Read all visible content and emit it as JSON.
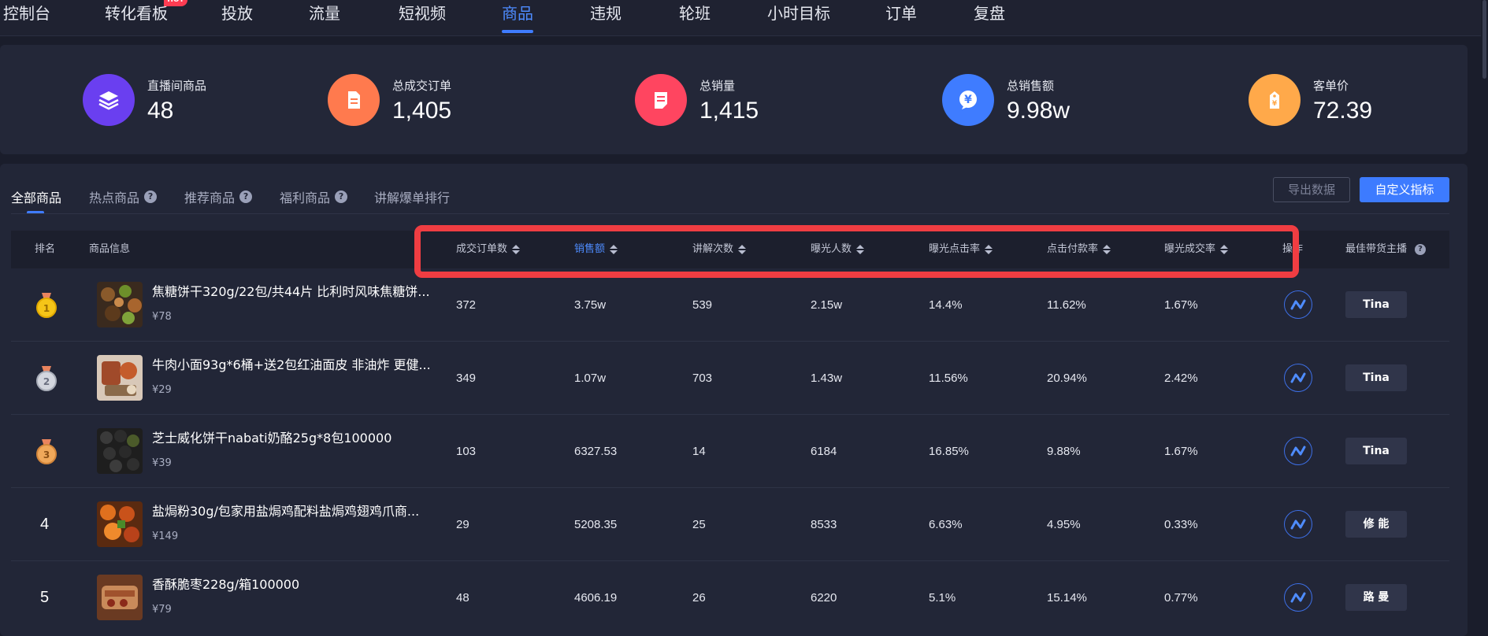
{
  "nav": {
    "items": [
      "控制台",
      "转化看板",
      "投放",
      "流量",
      "短视频",
      "商品",
      "违规",
      "轮班",
      "小时目标",
      "订单",
      "复盘"
    ],
    "hot_badge": "HOT",
    "active": "商品"
  },
  "stats": [
    {
      "label": "直播间商品",
      "value": "48",
      "icon": "layers-icon",
      "color": "#6a3ff0"
    },
    {
      "label": "总成交订单",
      "value": "1,405",
      "icon": "document-icon",
      "color": "#ff7a4e"
    },
    {
      "label": "总销量",
      "value": "1,415",
      "icon": "note-icon",
      "color": "#ff4560"
    },
    {
      "label": "总销售额",
      "value": "9.98w",
      "icon": "yuan-icon",
      "color": "#3f7cff"
    },
    {
      "label": "客单价",
      "value": "72.39",
      "icon": "price-tag-icon",
      "color": "#ffa94a"
    }
  ],
  "tabs": [
    {
      "label": "全部商品",
      "help": false,
      "active": true
    },
    {
      "label": "热点商品",
      "help": true
    },
    {
      "label": "推荐商品",
      "help": true
    },
    {
      "label": "福利商品",
      "help": true
    },
    {
      "label": "讲解爆单排行",
      "help": false
    }
  ],
  "actions": {
    "export": "导出数据",
    "custom": "自定义指标"
  },
  "table": {
    "headers": {
      "rank": "排名",
      "product": "商品信息",
      "orders": "成交订单数",
      "sales": "销售额",
      "explain": "讲解次数",
      "exposure": "曝光人数",
      "ctr": "曝光点击率",
      "pay_rate": "点击付款率",
      "conv": "曝光成交率",
      "op": "操作",
      "anchor": "最佳带货主播"
    },
    "sorted_column": "sales",
    "rows": [
      {
        "rank": "1",
        "medal": "gold",
        "name": "焦糖饼干320g/22包/共44片 比利时风味焦糖饼...",
        "price": "¥78",
        "orders": "372",
        "sales": "3.75w",
        "explain": "539",
        "exposure": "2.15w",
        "ctr": "14.4%",
        "pay_rate": "11.62%",
        "conv": "1.67%",
        "anchor": "Tina"
      },
      {
        "rank": "2",
        "medal": "silver",
        "name": "牛肉小面93g*6桶+送2包红油面皮 非油炸 更健...",
        "price": "¥29",
        "orders": "349",
        "sales": "1.07w",
        "explain": "703",
        "exposure": "1.43w",
        "ctr": "11.56%",
        "pay_rate": "20.94%",
        "conv": "2.42%",
        "anchor": "Tina"
      },
      {
        "rank": "3",
        "medal": "bronze",
        "name": "芝士威化饼干nabati奶酪25g*8包100000",
        "price": "¥39",
        "orders": "103",
        "sales": "6327.53",
        "explain": "14",
        "exposure": "6184",
        "ctr": "16.85%",
        "pay_rate": "9.88%",
        "conv": "1.67%",
        "anchor": "Tina"
      },
      {
        "rank": "4",
        "medal": "",
        "name": "盐焗粉30g/包家用盐焗鸡配料盐焗鸡翅鸡爪商...",
        "price": "¥149",
        "orders": "29",
        "sales": "5208.35",
        "explain": "25",
        "exposure": "8533",
        "ctr": "6.63%",
        "pay_rate": "4.95%",
        "conv": "0.33%",
        "anchor": "修 能"
      },
      {
        "rank": "5",
        "medal": "",
        "name": "香酥脆枣228g/箱100000",
        "price": "¥79",
        "orders": "48",
        "sales": "4606.19",
        "explain": "26",
        "exposure": "6220",
        "ctr": "5.1%",
        "pay_rate": "15.14%",
        "conv": "0.77%",
        "anchor": "路 曼"
      }
    ]
  }
}
